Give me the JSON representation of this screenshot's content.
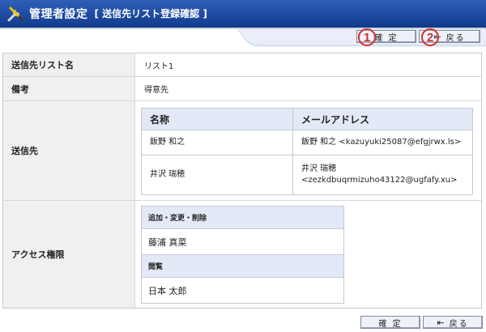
{
  "header": {
    "title": "管理者設定",
    "subtitle": "[ 送信先リスト登録確認 ]",
    "icon": "tools-icon"
  },
  "toolbar": {
    "confirm_label": "確 定",
    "back_label": "戻る",
    "badge_confirm": "1",
    "badge_back": "2"
  },
  "form": {
    "list_name_label": "送信先リスト名",
    "list_name_value": "リスト1",
    "remarks_label": "備考",
    "remarks_value": "得意先",
    "recipients_label": "送信先",
    "access_label": "アクセス権限"
  },
  "recipients": {
    "columns": [
      "名称",
      "メールアドレス"
    ],
    "rows": [
      {
        "name": "飯野 和之",
        "email": "飯野 和之 <kazuyuki25087@efgjrwx.ls>",
        "email_line1": "飯野 和之 <kazuyuki25087@efgjrwx.ls>",
        "email_line2": ""
      },
      {
        "name": "井沢 瑞穂",
        "email": "井沢 瑞穂 <zezkdbuqrmizuho43122@ugfafy.xu>",
        "email_line1": "井沢 瑞穂",
        "email_line2": "<zezkdbuqrmizuho43122@ugfafy.xu>"
      }
    ]
  },
  "access": {
    "edit_header": "追加・変更・削除",
    "edit_user": "藤浦 真菜",
    "view_header": "閲覧",
    "view_user": "日本 太郎"
  },
  "footer": {
    "confirm_label": "確 定",
    "back_label": "戻る"
  },
  "colors": {
    "header_blue": "#1c4aa3",
    "badge_red": "#d0302d",
    "label_bg": "#f0f0f0",
    "subheader_bg": "#e3e9f6"
  }
}
